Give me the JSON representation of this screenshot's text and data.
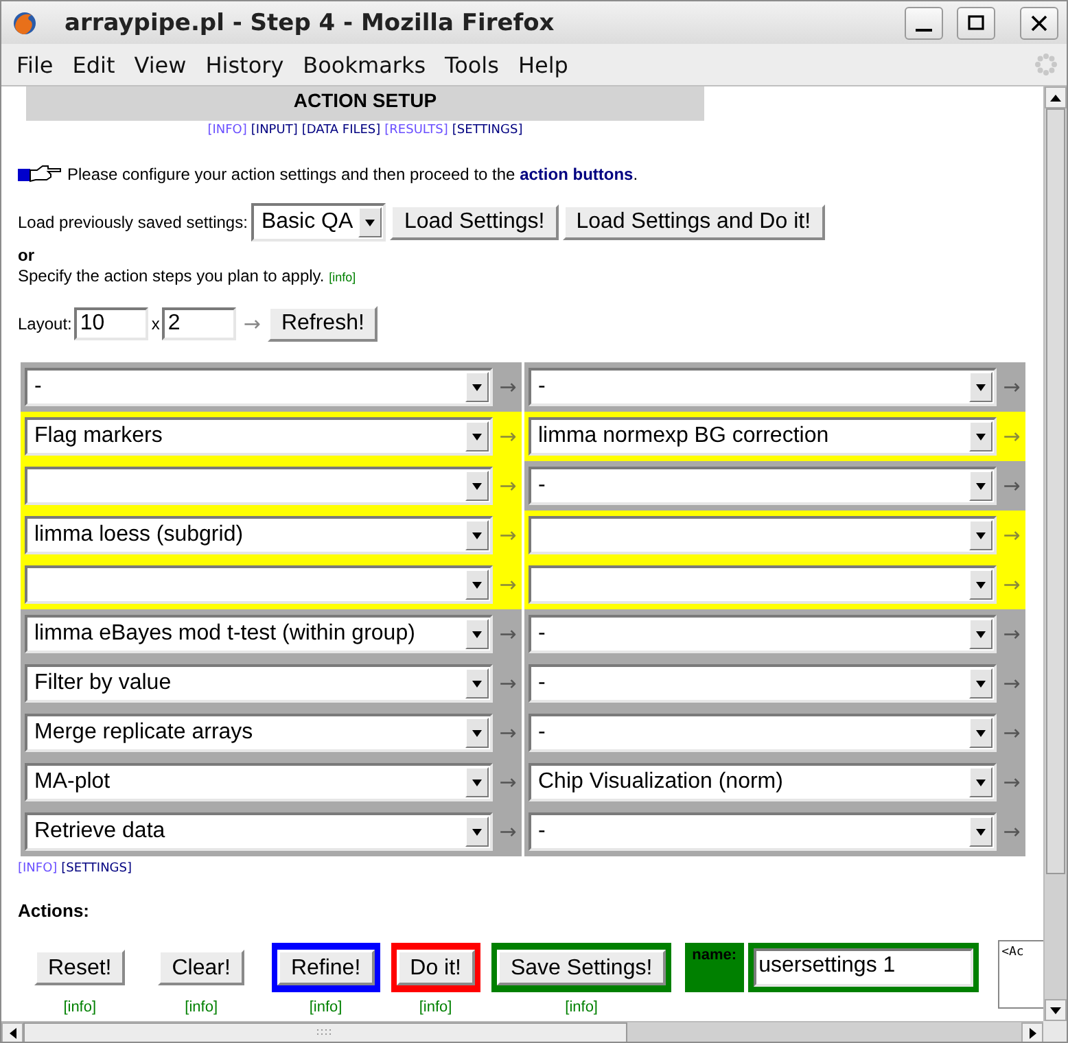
{
  "window": {
    "title": "arraypipe.pl - Step 4 - Mozilla Firefox"
  },
  "menu": [
    {
      "label": "File"
    },
    {
      "label": "Edit"
    },
    {
      "label": "View"
    },
    {
      "label": "History"
    },
    {
      "label": "Bookmarks"
    },
    {
      "label": "Tools"
    },
    {
      "label": "Help"
    }
  ],
  "page": {
    "heading": "ACTION SETUP",
    "nav": [
      {
        "label": "[INFO]",
        "visited": true
      },
      {
        "label": "[INPUT]",
        "visited": false
      },
      {
        "label": "[DATA FILES]",
        "visited": false
      },
      {
        "label": "[RESULTS]",
        "visited": true
      },
      {
        "label": "[SETTINGS]",
        "visited": false
      }
    ],
    "instruction": {
      "text": "Please configure your action settings and then proceed to the",
      "link": "action buttons",
      "after": "."
    },
    "load": {
      "label": "Load previously saved settings:",
      "value": "Basic QA",
      "buttons": [
        "Load Settings!",
        "Load Settings and Do it!"
      ]
    },
    "or": "or",
    "specify": {
      "text": "Specify the action steps you plan to apply.",
      "info": "[info]"
    },
    "layout": {
      "label": "Layout:",
      "rows": "10",
      "times": "x",
      "cols": "2",
      "arrow": "→",
      "button": "Refresh!"
    },
    "grid": [
      [
        {
          "value": "-",
          "active": false,
          "arrow": "→"
        },
        {
          "value": "-",
          "active": false,
          "arrow": "→"
        }
      ],
      [
        {
          "value": "Flag markers",
          "active": true,
          "arrow": "→"
        },
        {
          "value": "limma normexp BG correction",
          "active": true,
          "arrow": "→"
        }
      ],
      [
        {
          "active": true,
          "arrow": "→"
        },
        {
          "value": "-",
          "active": false,
          "arrow": "→"
        }
      ],
      [
        {
          "value": "limma loess (subgrid)",
          "active": true,
          "arrow": "→"
        },
        {
          "active": true,
          "arrow": "→"
        }
      ],
      [
        {
          "active": true,
          "arrow": "→"
        },
        {
          "active": true,
          "arrow": "→"
        }
      ],
      [
        {
          "value": "limma eBayes mod t-test (within group)",
          "active": false,
          "arrow": "→"
        },
        {
          "value": "-",
          "active": false,
          "arrow": "→"
        }
      ],
      [
        {
          "value": "Filter by value",
          "active": false,
          "arrow": "→"
        },
        {
          "value": "-",
          "active": false,
          "arrow": "→"
        }
      ],
      [
        {
          "value": "Merge replicate arrays",
          "active": false,
          "arrow": "→"
        },
        {
          "value": "-",
          "active": false,
          "arrow": "→"
        }
      ],
      [
        {
          "value": "MA-plot",
          "active": false,
          "arrow": "→"
        },
        {
          "value": "Chip Visualization (norm)",
          "active": false,
          "arrow": "→"
        }
      ],
      [
        {
          "value": "Retrieve data",
          "active": false,
          "arrow": "→"
        },
        {
          "value": "-",
          "active": false,
          "arrow": "→"
        }
      ]
    ],
    "grid_links": [
      {
        "label": "[INFO]",
        "visited": true
      },
      {
        "label": "[SETTINGS]",
        "visited": false
      }
    ],
    "actions_heading": "Actions:",
    "actions": [
      {
        "label": "Reset!",
        "info": "[info]"
      },
      {
        "label": "Clear!",
        "info": "[info]"
      },
      {
        "label": "Refine!",
        "info": "[info]",
        "color": "#0000ff"
      },
      {
        "label": "Do it!",
        "info": "[info]",
        "color": "#ff0000"
      },
      {
        "label": "Save Settings!",
        "info": "[info]",
        "color": "#008000"
      }
    ],
    "save_name": {
      "label": "name:",
      "value": "usersettings 1"
    },
    "log_box": "<Ac"
  }
}
